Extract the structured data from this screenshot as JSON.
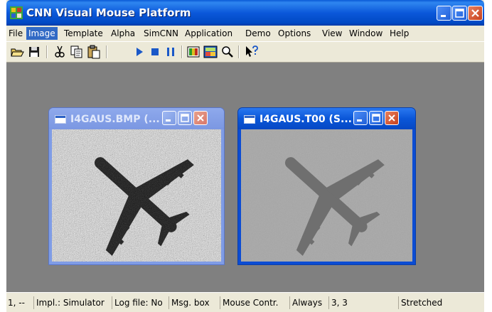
{
  "window": {
    "title": "CNN Visual Mouse Platform"
  },
  "menu": [
    {
      "label": "File"
    },
    {
      "label": "Image"
    },
    {
      "label": "Template"
    },
    {
      "label": "Alpha"
    },
    {
      "label": "SimCNN"
    },
    {
      "label": "Application"
    },
    {
      "label": "Demo"
    },
    {
      "label": "Options"
    },
    {
      "label": "View"
    },
    {
      "label": "Window"
    },
    {
      "label": "Help"
    }
  ],
  "menu_active": "Image",
  "toolbar": [
    {
      "icon": "open-folder-icon"
    },
    {
      "icon": "save-icon"
    },
    {
      "icon": "cut-icon"
    },
    {
      "icon": "copy-icon"
    },
    {
      "icon": "paste-icon"
    },
    {
      "icon": "play-icon"
    },
    {
      "icon": "stop-icon"
    },
    {
      "icon": "pause-icon"
    },
    {
      "icon": "palette-icon"
    },
    {
      "icon": "image-view-icon"
    },
    {
      "icon": "zoom-icon"
    },
    {
      "icon": "context-help-icon"
    }
  ],
  "child_windows": [
    {
      "title": "I4GAUS.BMP (...",
      "state": "inactive",
      "image": "noisy airplane image"
    },
    {
      "title": "I4GAUS.T00 (S...",
      "state": "active",
      "image": "filtered airplane image"
    }
  ],
  "status": [
    "1, --",
    "Impl.: Simulator",
    "Log file: No",
    "Msg. box",
    "Mouse Contr.",
    "Always",
    "3, 3",
    "Stretched"
  ],
  "colors": {
    "title_bar": "#0b58da",
    "workspace": "#808080",
    "menu_highlight": "#316ac5",
    "close_button": "#d5502d"
  }
}
